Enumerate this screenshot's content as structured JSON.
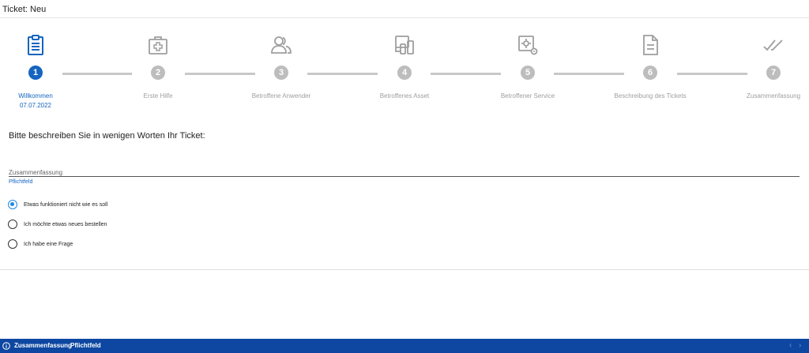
{
  "header": {
    "title": "Ticket: Neu"
  },
  "steps": [
    {
      "number": "1",
      "label": "Willkommen",
      "date": "07.07.2022",
      "icon": "clipboard-icon",
      "active": true
    },
    {
      "number": "2",
      "label": "Erste Hilfe",
      "icon": "first-aid-icon",
      "active": false
    },
    {
      "number": "3",
      "label": "Betroffene Anwender",
      "icon": "users-icon",
      "active": false
    },
    {
      "number": "4",
      "label": "Betroffenes Asset",
      "icon": "devices-icon",
      "active": false
    },
    {
      "number": "5",
      "label": "Betroffener Service",
      "icon": "service-gear-icon",
      "active": false
    },
    {
      "number": "6",
      "label": "Beschreibung des Tickets",
      "icon": "document-icon",
      "active": false
    },
    {
      "number": "7",
      "label": "Zusammenfassung",
      "icon": "double-check-icon",
      "active": false
    }
  ],
  "form": {
    "question": "Bitte beschreiben Sie in wenigen Worten Ihr Ticket:",
    "summary_placeholder": "Zusammenfassung",
    "summary_value": "",
    "required_hint": "Pflichtfeld",
    "options": [
      {
        "label": "Etwas funktioniert nicht wie es soll",
        "checked": true
      },
      {
        "label": "Ich möchte etwas neues bestellen",
        "checked": false
      },
      {
        "label": "Ich habe eine Frage",
        "checked": false
      }
    ]
  },
  "status_bar": {
    "field": "Zusammenfassung",
    "message": "Pflichtfeld",
    "prev_icon": "‹",
    "next_icon": "›"
  },
  "colors": {
    "accent": "#1565c0",
    "inactive": "#bdbdbd",
    "status_bar": "#0d47a1",
    "radio_checked": "#1e88e5"
  }
}
